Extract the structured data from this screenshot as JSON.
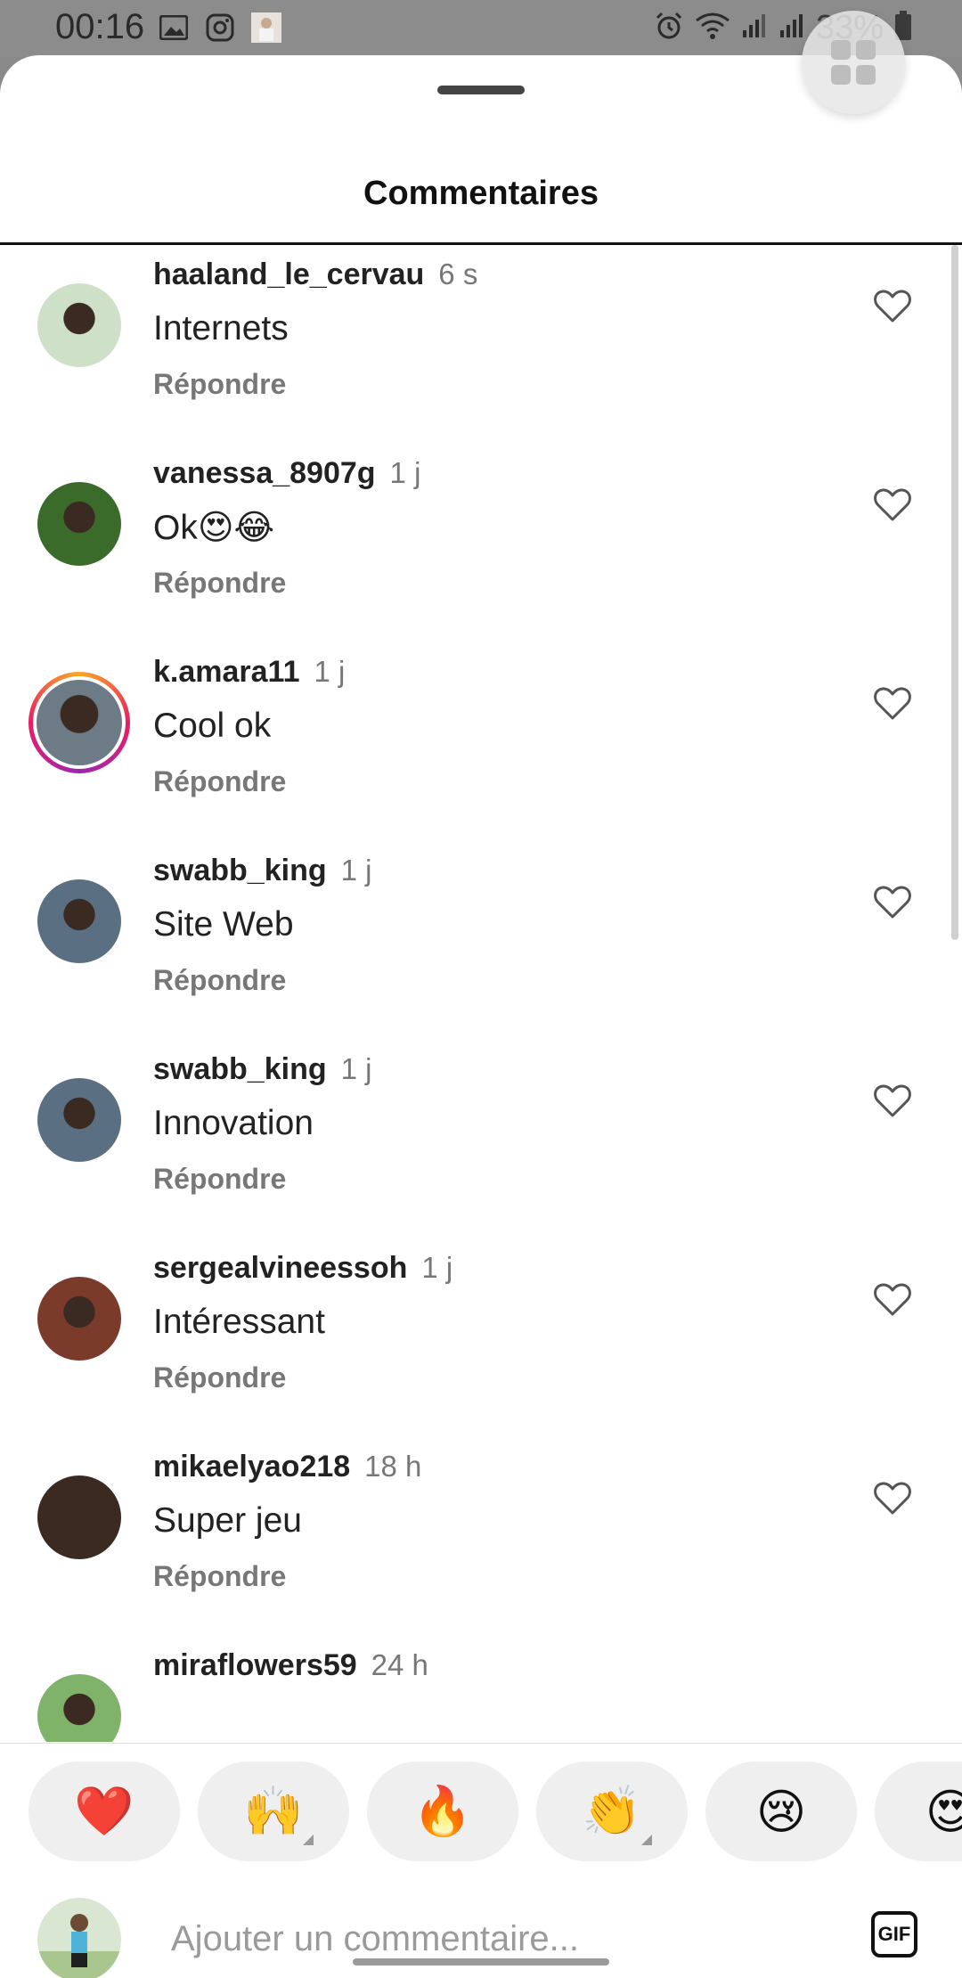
{
  "status_bar": {
    "time": "00:16",
    "battery": "33%",
    "icons_left": [
      "image-icon",
      "instagram-icon",
      "profile-thumbnail-icon"
    ],
    "icons_right": [
      "alarm-icon",
      "wifi-icon",
      "signal-icon",
      "signal-icon",
      "battery-icon"
    ]
  },
  "sheet": {
    "title": "Commentaires"
  },
  "comments": [
    {
      "username": "haaland_le_cervau",
      "time": "6 s",
      "text": "Internets",
      "reply": "Répondre",
      "avatar_color": "#cfe0c8",
      "story_ring": false
    },
    {
      "username": "vanessa_8907g",
      "time": "1 j",
      "text": "Ok😍😂",
      "reply": "Répondre",
      "avatar_color": "#3a6b2a",
      "story_ring": false
    },
    {
      "username": "k.amara11",
      "time": "1 j",
      "text": "Cool ok",
      "reply": "Répondre",
      "avatar_color": "#6c7b86",
      "story_ring": true
    },
    {
      "username": "swabb_king",
      "time": "1 j",
      "text": "Site Web",
      "reply": "Répondre",
      "avatar_color": "#5b6f82",
      "story_ring": false
    },
    {
      "username": "swabb_king",
      "time": "1 j",
      "text": "Innovation",
      "reply": "Répondre",
      "avatar_color": "#5b6f82",
      "story_ring": false
    },
    {
      "username": "sergealvineessoh",
      "time": "1 j",
      "text": "Intéressant",
      "reply": "Répondre",
      "avatar_color": "#7a3b2a",
      "story_ring": false
    },
    {
      "username": "mikaelyao218",
      "time": "18 h",
      "text": "Super jeu",
      "reply": "Répondre",
      "avatar_color": "#3b2a22",
      "story_ring": false
    },
    {
      "username": "miraflowers59",
      "time": "24 h",
      "text": "",
      "reply": "",
      "avatar_color": "#7fb36a",
      "story_ring": false
    }
  ],
  "reactions": [
    "❤️",
    "🙌",
    "🔥",
    "👏",
    "😢",
    "😍"
  ],
  "composer": {
    "placeholder": "Ajouter un commentaire...",
    "gif_label": "GIF"
  },
  "colors": {
    "accent_text": "#222222",
    "muted_text": "#777777",
    "heart_outline": "#555555"
  }
}
